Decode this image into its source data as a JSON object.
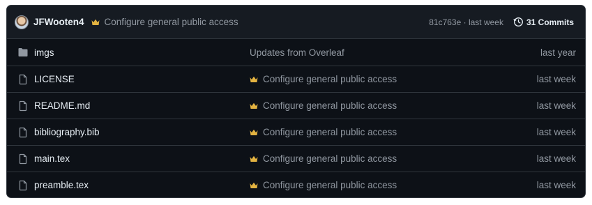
{
  "header": {
    "author": "JFWooten4",
    "commit_message": "Configure general public access",
    "commit_hash_time": "81c763e · last week",
    "commits_label": "31 Commits"
  },
  "files": [
    {
      "name": "imgs",
      "type": "folder",
      "message": "Updates from Overleaf",
      "has_badge": false,
      "date": "last year"
    },
    {
      "name": "LICENSE",
      "type": "file",
      "message": "Configure general public access",
      "has_badge": true,
      "date": "last week"
    },
    {
      "name": "README.md",
      "type": "file",
      "message": "Configure general public access",
      "has_badge": true,
      "date": "last week"
    },
    {
      "name": "bibliography.bib",
      "type": "file",
      "message": "Configure general public access",
      "has_badge": true,
      "date": "last week"
    },
    {
      "name": "main.tex",
      "type": "file",
      "message": "Configure general public access",
      "has_badge": true,
      "date": "last week"
    },
    {
      "name": "preamble.tex",
      "type": "file",
      "message": "Configure general public access",
      "has_badge": true,
      "date": "last week"
    }
  ],
  "colors": {
    "background": "#0d1117",
    "header_bg": "#161b22",
    "border": "#30363d",
    "text": "#e6edf3",
    "muted": "#9198a1",
    "badge": "#e3b341"
  },
  "icons": {
    "folder": "folder-icon",
    "file": "file-icon",
    "badge": "crown-icon",
    "history": "history-icon"
  }
}
